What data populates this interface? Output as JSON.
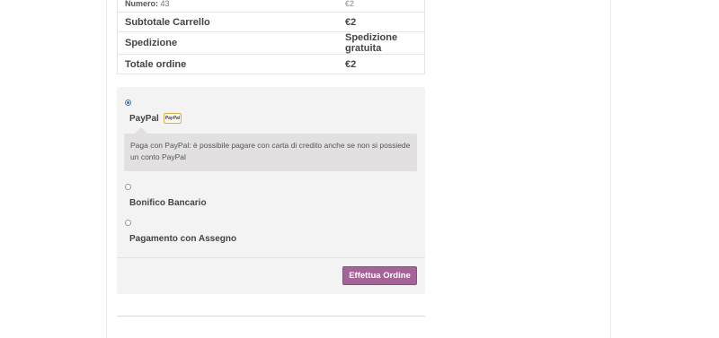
{
  "order_summary": {
    "item_meta_label": "Numero:",
    "item_meta_value": "43",
    "item_total": "€2",
    "rows": [
      {
        "label": "Subtotale Carrello",
        "value": "€2"
      },
      {
        "label": "Spedizione",
        "value": "Spedizione gratuita"
      },
      {
        "label": "Totale ordine",
        "value": "€2"
      }
    ]
  },
  "payment": {
    "methods": [
      {
        "label": "PayPal",
        "selected": true,
        "badge": "PayPal",
        "description": "Paga con PayPal: è possibile pagare con carta di credito anche se non si possiede un conto PayPal"
      },
      {
        "label": "Bonifico Bancario",
        "selected": false
      },
      {
        "label": "Pagamento con Assegno",
        "selected": false
      }
    ],
    "place_order_label": "Effettua Ordine"
  },
  "colors": {
    "button": "#a46497",
    "radio_selected": "#3b6fb6",
    "panel": "#f3f3f3",
    "description_box": "#e2e0e1"
  }
}
